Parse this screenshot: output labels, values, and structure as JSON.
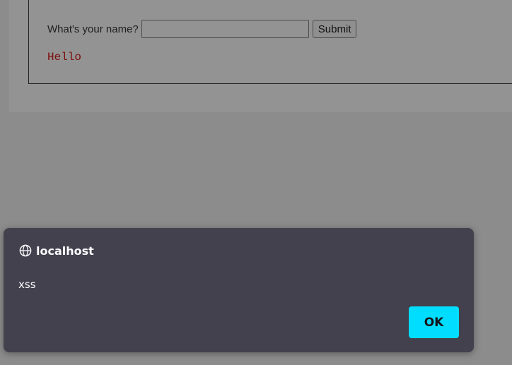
{
  "page": {
    "form": {
      "label": "What's your name?",
      "input_value": "",
      "submit_label": "Submit"
    },
    "greeting": "Hello"
  },
  "dialog": {
    "origin": "localhost",
    "origin_icon": "globe-icon",
    "message": "xss",
    "ok_label": "OK",
    "accent_color": "#00ddff",
    "background_color": "#42414d"
  }
}
